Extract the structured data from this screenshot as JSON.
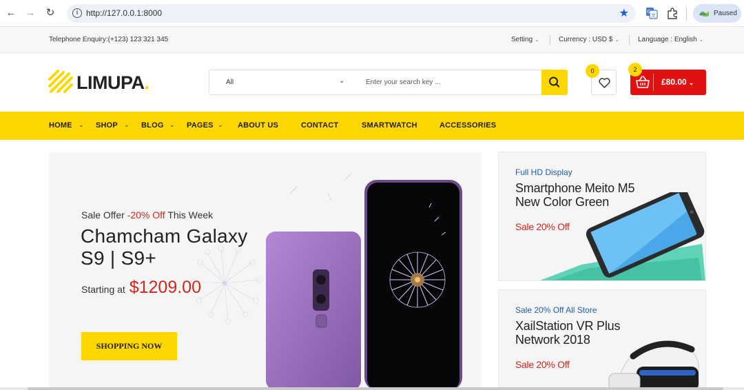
{
  "browser": {
    "url": "http://127.0.0.1:8000",
    "profile_status": "Paused",
    "icons": [
      "back-icon",
      "forward-icon",
      "reload-icon",
      "site-info-icon",
      "bookmark-star-icon",
      "translate-icon",
      "extensions-icon"
    ]
  },
  "topbar": {
    "telephone": "Telephone Enquiry:(+123) 123 321 345",
    "setting_label": "Setting",
    "currency_label": "Currency : USD $",
    "language_label": "Language : English"
  },
  "header": {
    "logo_text": "LIMUPA",
    "logo_dot": ".",
    "search_category": "All",
    "search_placeholder": "Enter your search key ...",
    "wishlist_count": "0",
    "cart_count": "2",
    "cart_total": "£80.00"
  },
  "menu": {
    "items": [
      {
        "label": "HOME"
      },
      {
        "label": "SHOP"
      },
      {
        "label": "BLOG"
      },
      {
        "label": "PAGES"
      },
      {
        "label": "ABOUT US"
      },
      {
        "label": "CONTACT"
      },
      {
        "label": "SMARTWATCH"
      },
      {
        "label": "ACCESSORIES"
      }
    ]
  },
  "hero": {
    "offer_prefix": "Sale Offer",
    "offer_discount": "-20% Off",
    "offer_suffix": "This Week",
    "title_line1": "Chamcham Galaxy",
    "title_line2": "S9 | S9+",
    "starting_label": "Starting at",
    "price": "$1209.00",
    "button_label": "SHOPPING NOW"
  },
  "side_banners": [
    {
      "kicker": "Full HD Display",
      "title_line1": "Smartphone Meito M5",
      "title_line2": "New Color Green",
      "sale": "Sale 20% Off"
    },
    {
      "kicker": "Sale 20% Off All Store",
      "title_line1": "XailStation VR Plus",
      "title_line2": "Network 2018",
      "sale": "Sale 20% Off"
    }
  ],
  "colors": {
    "brand_yellow": "#fed700",
    "cart_red": "#e21111",
    "sale_red": "#d0261d",
    "kicker_blue": "#1f5fa8"
  }
}
